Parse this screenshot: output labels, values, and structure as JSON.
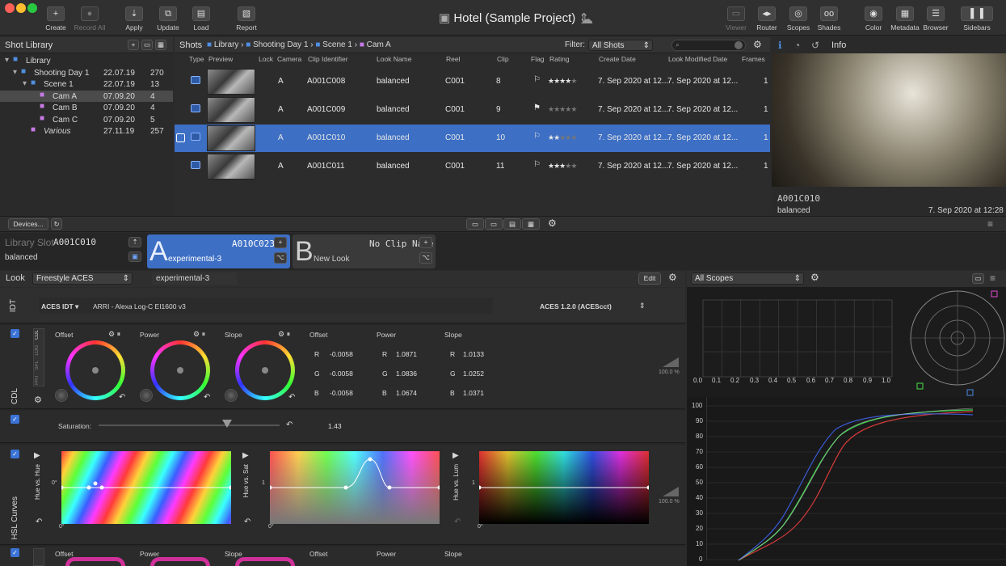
{
  "toolbar": {
    "buttons": [
      {
        "label": "Create",
        "icon": "plus-icon"
      },
      {
        "label": "Record All",
        "icon": "record-icon",
        "disabled": true
      },
      {
        "label": "Apply",
        "icon": "apply-icon"
      },
      {
        "label": "Update",
        "icon": "update-icon"
      },
      {
        "label": "Load",
        "icon": "load-icon"
      },
      {
        "label": "Report",
        "icon": "report-icon"
      }
    ],
    "project_title": "Hotel (Sample Project)",
    "right_buttons": [
      {
        "label": "Viewer",
        "disabled": true
      },
      {
        "label": "Router"
      },
      {
        "label": "Scopes"
      },
      {
        "label": "Shades"
      },
      {
        "label": "Color"
      },
      {
        "label": "Metadata"
      },
      {
        "label": "Browser"
      },
      {
        "label": "Sidebars"
      }
    ]
  },
  "library": {
    "title": "Shot Library",
    "items": [
      {
        "name": "Library",
        "date": "",
        "count": "",
        "level": 0,
        "type": "folder"
      },
      {
        "name": "Shooting Day 1",
        "date": "22.07.19",
        "count": "270",
        "level": 1,
        "type": "folder"
      },
      {
        "name": "Scene 1",
        "date": "22.07.19",
        "count": "13",
        "level": 2,
        "type": "folder"
      },
      {
        "name": "Cam A",
        "date": "07.09.20",
        "count": "4",
        "level": 3,
        "type": "cam",
        "selected": true
      },
      {
        "name": "Cam B",
        "date": "07.09.20",
        "count": "4",
        "level": 3,
        "type": "cam"
      },
      {
        "name": "Cam C",
        "date": "07.09.20",
        "count": "5",
        "level": 3,
        "type": "cam"
      },
      {
        "name": "Various",
        "date": "27.11.19",
        "count": "257",
        "level": 2,
        "type": "cam",
        "italic": true
      }
    ]
  },
  "shots": {
    "title": "Shots",
    "breadcrumb": [
      "Library",
      "Shooting Day 1",
      "Scene 1",
      "Cam A"
    ],
    "filter_label": "Filter:",
    "filter_value": "All Shots",
    "columns": [
      "Type",
      "Preview",
      "Lock",
      "Camera",
      "Clip Identifier",
      "Look Name",
      "Reel",
      "Clip",
      "Flag",
      "Rating",
      "Create Date",
      "Look Modified Date",
      "Frames"
    ],
    "rows": [
      {
        "camera": "A",
        "clip_id": "A001C008",
        "look": "balanced",
        "reel": "C001",
        "clip": "8",
        "rating": "★★★★★",
        "rating_filled": 4,
        "create": "7. Sep 2020 at 12...",
        "modified": "7. Sep 2020 at 12...",
        "frames": "1"
      },
      {
        "camera": "A",
        "clip_id": "A001C009",
        "look": "balanced",
        "reel": "C001",
        "clip": "9",
        "rating": "★★★★★",
        "rating_filled": 0,
        "create": "7. Sep 2020 at 12...",
        "modified": "7. Sep 2020 at 12...",
        "frames": "1"
      },
      {
        "camera": "A",
        "clip_id": "A001C010",
        "look": "balanced",
        "reel": "C001",
        "clip": "10",
        "rating": "★★★★★",
        "rating_filled": 2,
        "create": "7. Sep 2020 at 12...",
        "modified": "7. Sep 2020 at 12...",
        "frames": "1",
        "selected": true
      },
      {
        "camera": "A",
        "clip_id": "A001C011",
        "look": "balanced",
        "reel": "C001",
        "clip": "11",
        "rating": "★★★★★",
        "rating_filled": 3,
        "create": "7. Sep 2020 at 12...",
        "modified": "7. Sep 2020 at 12...",
        "frames": "1"
      }
    ]
  },
  "info": {
    "title": "Info",
    "clip": "A001C010",
    "look": "balanced",
    "date": "7. Sep 2020 at 12:28"
  },
  "midbar": {
    "devices": "Devices..."
  },
  "slots": {
    "library_slot_label": "Library Slot",
    "library_clip": "A001C010",
    "library_look": "balanced",
    "a_letter": "A",
    "a_clip": "A010C023",
    "a_look": "experimental-3",
    "b_letter": "B",
    "b_clip": "No Clip Name",
    "b_look": "New Look"
  },
  "look": {
    "label": "Look",
    "type": "Freestyle ACES",
    "name": "experimental-3",
    "edit": "Edit"
  },
  "idt": {
    "section": "IDT",
    "mode": "ACES IDT",
    "camera": "ARRI - Alexa Log-C EI1600 v3",
    "output": "ACES 1.2.0 (ACEScct)"
  },
  "cdl": {
    "section": "CDL",
    "tabs": [
      "CDL",
      "LOG",
      "SPL",
      "PRT"
    ],
    "wheel_labels": [
      "Offset",
      "Power",
      "Slope"
    ],
    "value_groups": [
      {
        "title": "Offset",
        "R": "-0.0058",
        "G": "-0.0058",
        "B": "-0.0058"
      },
      {
        "title": "Power",
        "R": "1.0871",
        "G": "1.0836",
        "B": "1.0674"
      },
      {
        "title": "Slope",
        "R": "1.0133",
        "G": "1.0252",
        "B": "1.0371"
      }
    ],
    "level_label": "100.0 %"
  },
  "saturation": {
    "label": "Saturation:",
    "value": "1.43"
  },
  "hsl": {
    "section": "HSL Curves",
    "curves": [
      {
        "label": "Hue vs. Hue",
        "y_mark": "0°",
        "x_mark": "0°"
      },
      {
        "label": "Hue vs. Sat",
        "y_mark": "1",
        "x_mark": "0°"
      },
      {
        "label": "Hue vs. Lum",
        "y_mark": "1",
        "x_mark": "0°"
      }
    ],
    "level_label": "100.0 %"
  },
  "bottom_cdl_labels": [
    "Offset",
    "Power",
    "Slope",
    "Offset",
    "Power",
    "Slope"
  ],
  "scopes": {
    "select": "All Scopes",
    "top_axis": [
      "0.0",
      "0.1",
      "0.2",
      "0.3",
      "0.4",
      "0.5",
      "0.6",
      "0.7",
      "0.8",
      "0.9",
      "1.0"
    ],
    "y_axis": [
      "100",
      "90",
      "80",
      "70",
      "60",
      "50",
      "40",
      "30",
      "20",
      "10",
      "0"
    ]
  },
  "colors": {
    "accent": "#3d6fc4",
    "bg": "#2b2b2b"
  }
}
